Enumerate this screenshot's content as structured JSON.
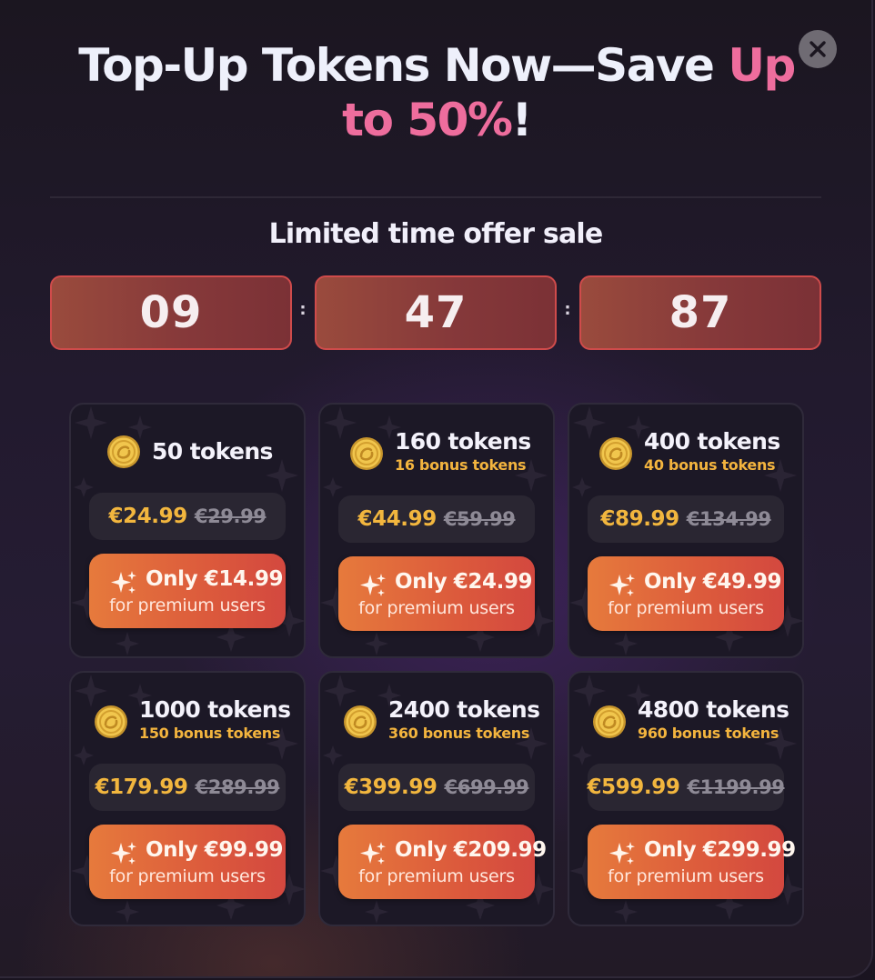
{
  "modal": {
    "title_part1": "Top-Up Tokens Now—Save ",
    "title_accent": "Up to 50%",
    "title_end": "!",
    "close_icon": "close-icon",
    "subtitle": "Limited time offer sale",
    "timer": {
      "hours": "09",
      "minutes": "47",
      "seconds": "87",
      "separator": ":"
    }
  },
  "colors": {
    "accent_pink": "#ee6d9d",
    "bonus_gold": "#f3b43e",
    "button_orange": "#e67a3c",
    "timer_border": "#cf4b4b"
  },
  "packages": [
    {
      "tokens": "50 tokens",
      "bonus": "",
      "price": "€24.99",
      "old_price": "€29.99",
      "premium_price": "Only €14.99",
      "premium_note": "for premium users",
      "icon": "coin-icon"
    },
    {
      "tokens": "160 tokens",
      "bonus": "16 bonus tokens",
      "price": "€44.99",
      "old_price": "€59.99",
      "premium_price": "Only €24.99",
      "premium_note": "for premium users",
      "icon": "coin-icon"
    },
    {
      "tokens": "400 tokens",
      "bonus": "40 bonus tokens",
      "price": "€89.99",
      "old_price": "€134.99",
      "premium_price": "Only €49.99",
      "premium_note": "for premium users",
      "icon": "coin-icon"
    },
    {
      "tokens": "1000 tokens",
      "bonus": "150 bonus tokens",
      "price": "€179.99",
      "old_price": "€289.99",
      "premium_price": "Only €99.99",
      "premium_note": "for premium users",
      "icon": "coin-icon"
    },
    {
      "tokens": "2400 tokens",
      "bonus": "360 bonus tokens",
      "price": "€399.99",
      "old_price": "€699.99",
      "premium_price": "Only €209.99",
      "premium_note": "for premium users",
      "icon": "coin-icon"
    },
    {
      "tokens": "4800 tokens",
      "bonus": "960 bonus tokens",
      "price": "€599.99",
      "old_price": "€1199.99",
      "premium_price": "Only €299.99",
      "premium_note": "for premium users",
      "icon": "coin-icon"
    }
  ]
}
